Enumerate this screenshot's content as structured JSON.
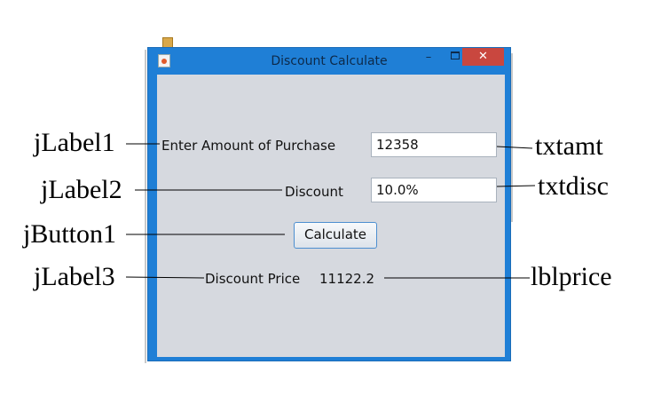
{
  "window": {
    "title": "Discount Calculate",
    "minimize_glyph": "–",
    "close_glyph": "✕"
  },
  "form": {
    "amount_label": "Enter Amount of Purchase",
    "amount_value": "12358",
    "discount_label": "Discount",
    "discount_value": "10.0%",
    "calculate_button": "Calculate",
    "price_label": "Discount Price",
    "price_value": "11122.2"
  },
  "annotations": {
    "label1": "jLabel1",
    "label2": "jLabel2",
    "button1": "jButton1",
    "label3": "jLabel3",
    "txtamt": "txtamt",
    "txtdisc": "txtdisc",
    "lblprice": "lblprice"
  },
  "icons": {
    "app_icon": "java-cup-icon",
    "minimize": "minimize-icon",
    "maximize": "maximize-icon",
    "close": "close-icon"
  },
  "colors": {
    "title_bar": "#1f7fd6",
    "close_button": "#c9473f",
    "panel": "#d6d9df"
  }
}
